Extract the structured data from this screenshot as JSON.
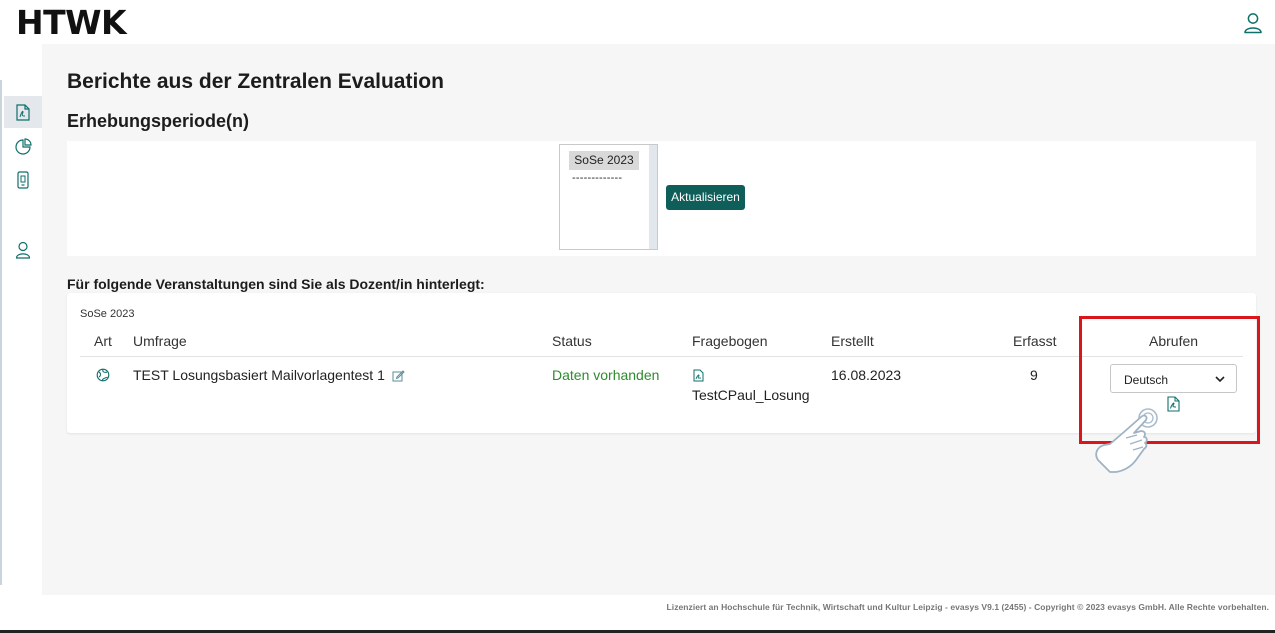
{
  "header": {
    "logo": "HTWK"
  },
  "sidebar": {
    "items": [
      {
        "icon": "pdf-report-icon",
        "active": true
      },
      {
        "icon": "pie-chart-icon",
        "active": false
      },
      {
        "icon": "mobile-device-icon",
        "active": false
      },
      {
        "icon": "user-icon",
        "active": false
      }
    ]
  },
  "page": {
    "title": "Berichte aus der Zentralen Evaluation",
    "period_section_title": "Erhebungsperiode(n)",
    "period_options": [
      "SoSe 2023",
      "-------------"
    ],
    "refresh_button": "Aktualisieren",
    "courses_title": "Für folgende Veranstaltungen sind Sie als Dozent/in hinterlegt:"
  },
  "table": {
    "semester": "SoSe 2023",
    "headers": {
      "art": "Art",
      "umfrage": "Umfrage",
      "status": "Status",
      "fragebogen": "Fragebogen",
      "erstellt": "Erstellt",
      "erfasst": "Erfasst",
      "abrufen": "Abrufen"
    },
    "rows": [
      {
        "art_icon": "globe-survey-icon",
        "umfrage": "TEST Losungsbasiert Mailvorlagentest 1",
        "status": "Daten vorhanden",
        "fragebogen": "TestCPaul_Losung",
        "erstellt": "16.08.2023",
        "erfasst": "9",
        "language": "Deutsch"
      }
    ]
  },
  "colors": {
    "accent_button": "#0f5e59",
    "status_green": "#2e8b2e",
    "highlight_red": "#d9161c"
  },
  "footer": {
    "text": "Lizenziert an Hochschule für Technik, Wirtschaft und Kultur Leipzig - evasys V9.1 (2455) - Copyright © 2023 evasys GmbH. Alle Rechte vorbehalten."
  }
}
